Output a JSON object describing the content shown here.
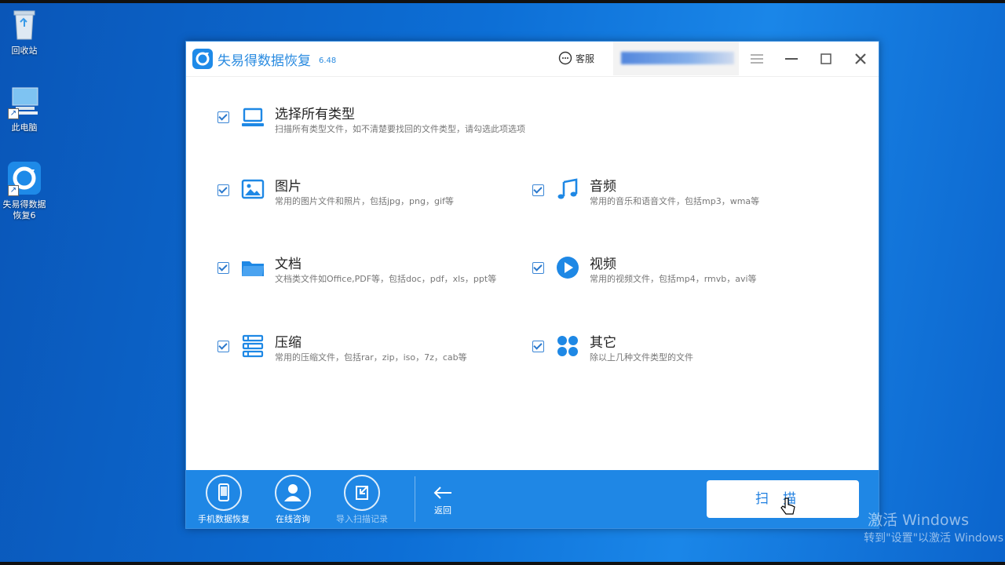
{
  "desktop": {
    "icons": [
      {
        "label": "回收站"
      },
      {
        "label": "此电脑"
      },
      {
        "label": "失易得数据恢复6"
      }
    ]
  },
  "app": {
    "title": "失易得数据恢复",
    "version": "6.48",
    "service_label": "客服",
    "accent": "#1f87e5"
  },
  "items": {
    "all": {
      "title": "选择所有类型",
      "desc": "扫描所有类型文件，如不清楚要找回的文件类型，请勾选此项选项",
      "checked": true
    },
    "images": {
      "title": "图片",
      "desc": "常用的图片文件和照片，包括jpg，png，gif等",
      "checked": true
    },
    "audio": {
      "title": "音频",
      "desc": "常用的音乐和语音文件，包括mp3，wma等",
      "checked": true
    },
    "docs": {
      "title": "文档",
      "desc": "文档类文件如Office,PDF等，包括doc，pdf，xls，ppt等",
      "checked": true
    },
    "video": {
      "title": "视频",
      "desc": "常用的视频文件，包括mp4，rmvb，avi等",
      "checked": true
    },
    "archive": {
      "title": "压缩",
      "desc": "常用的压缩文件，包括rar，zip，iso，7z，cab等",
      "checked": true
    },
    "other": {
      "title": "其它",
      "desc": "除以上几种文件类型的文件",
      "checked": true
    }
  },
  "bottom": {
    "phone_recovery": "手机数据恢复",
    "online_consult": "在线咨询",
    "import_record": "导入扫描记录",
    "back": "返回",
    "scan": "扫描"
  },
  "watermark": {
    "line1": "激活 Windows",
    "line2": "转到\"设置\"以激活 Windows"
  }
}
